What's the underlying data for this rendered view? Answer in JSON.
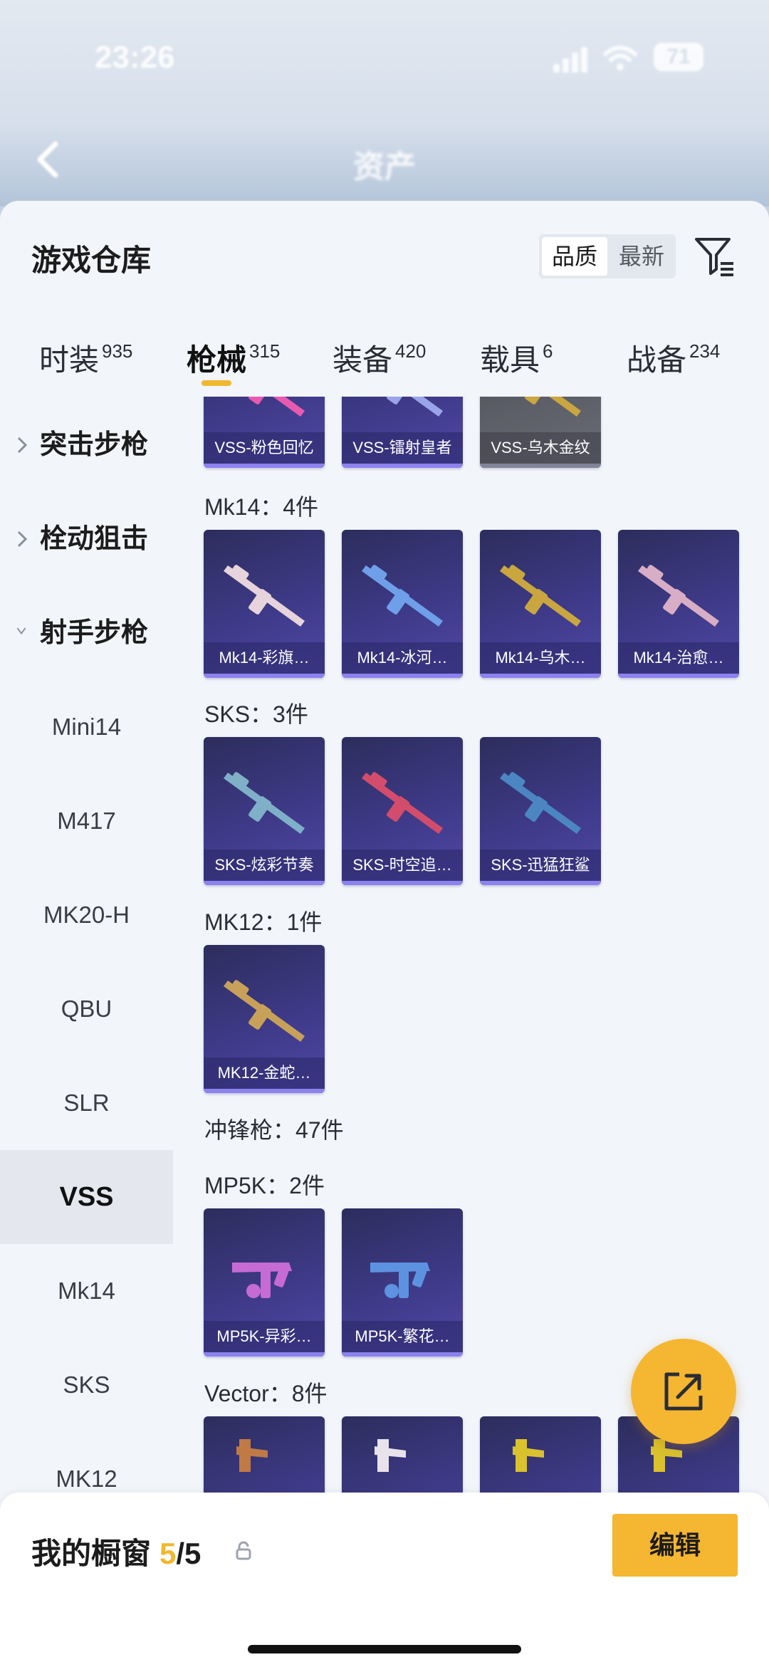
{
  "status_bar": {
    "time": "23:26",
    "battery": "71"
  },
  "nav": {
    "title": "资产"
  },
  "sheet": {
    "title": "游戏仓库",
    "sort_options": [
      {
        "label": "品质"
      },
      {
        "label": "最新"
      }
    ]
  },
  "tabs": [
    {
      "label": "时装",
      "count": "935"
    },
    {
      "label": "枪械",
      "count": "315"
    },
    {
      "label": "装备",
      "count": "420"
    },
    {
      "label": "载具",
      "count": "6"
    },
    {
      "label": "战备",
      "count": "234"
    }
  ],
  "sidebar": {
    "categories": [
      {
        "label": "突击步枪"
      },
      {
        "label": "栓动狙击"
      },
      {
        "label": "射手步枪"
      }
    ],
    "items": [
      {
        "label": "Mini14"
      },
      {
        "label": "M417"
      },
      {
        "label": "MK20-H"
      },
      {
        "label": "QBU"
      },
      {
        "label": "SLR"
      },
      {
        "label": "VSS"
      },
      {
        "label": "Mk14"
      },
      {
        "label": "SKS"
      },
      {
        "label": "MK12"
      }
    ]
  },
  "content": {
    "top_row": [
      {
        "label": "VSS-粉色回忆",
        "gun_color": "#e85ab0"
      },
      {
        "label": "VSS-镭射皇者",
        "gun_color": "#9aa4e8"
      },
      {
        "label": "VSS-乌木金纹",
        "gun_color": "#c9a640"
      }
    ],
    "groups": [
      {
        "header": "Mk14：4件",
        "items": [
          {
            "label": "Mk14-彩旗…",
            "gun_color": "#e7d3dc"
          },
          {
            "label": "Mk14-冰河…",
            "gun_color": "#6f9fe8"
          },
          {
            "label": "Mk14-乌木…",
            "gun_color": "#c9a640"
          },
          {
            "label": "Mk14-治愈…",
            "gun_color": "#d8aec6"
          }
        ]
      },
      {
        "header": "SKS：3件",
        "items": [
          {
            "label": "SKS-炫彩节奏",
            "gun_color": "#7fb0c8"
          },
          {
            "label": "SKS-时空追…",
            "gun_color": "#d24d6c"
          },
          {
            "label": "SKS-迅猛狂鲨",
            "gun_color": "#4c86c2"
          }
        ]
      },
      {
        "header": "MK12：1件",
        "items": [
          {
            "label": "MK12-金蛇…",
            "gun_color": "#c7a15a"
          }
        ]
      }
    ],
    "smg_header": "冲锋枪：47件",
    "smg_groups": [
      {
        "header": "MP5K：2件",
        "items": [
          {
            "label": "MP5K-异彩…",
            "gun_color": "#c66bd3"
          },
          {
            "label": "MP5K-繁花…",
            "gun_color": "#5d92e0"
          }
        ]
      },
      {
        "header": "Vector：8件",
        "items": [
          {
            "label": "",
            "gun_color": "#c07a45"
          },
          {
            "label": "",
            "gun_color": "#e8e2ea"
          },
          {
            "label": "",
            "gun_color": "#d9c22e"
          },
          {
            "label": "",
            "gun_color": "#d9c22e"
          }
        ]
      }
    ]
  },
  "bottom": {
    "window_label": "我的橱窗",
    "window_used": "5",
    "window_total": "/5",
    "edit_label": "编辑"
  },
  "colors": {
    "accent": "#f0b830",
    "card_purple": "#3e3a88",
    "sheet_bg": "#f2f5f9"
  }
}
